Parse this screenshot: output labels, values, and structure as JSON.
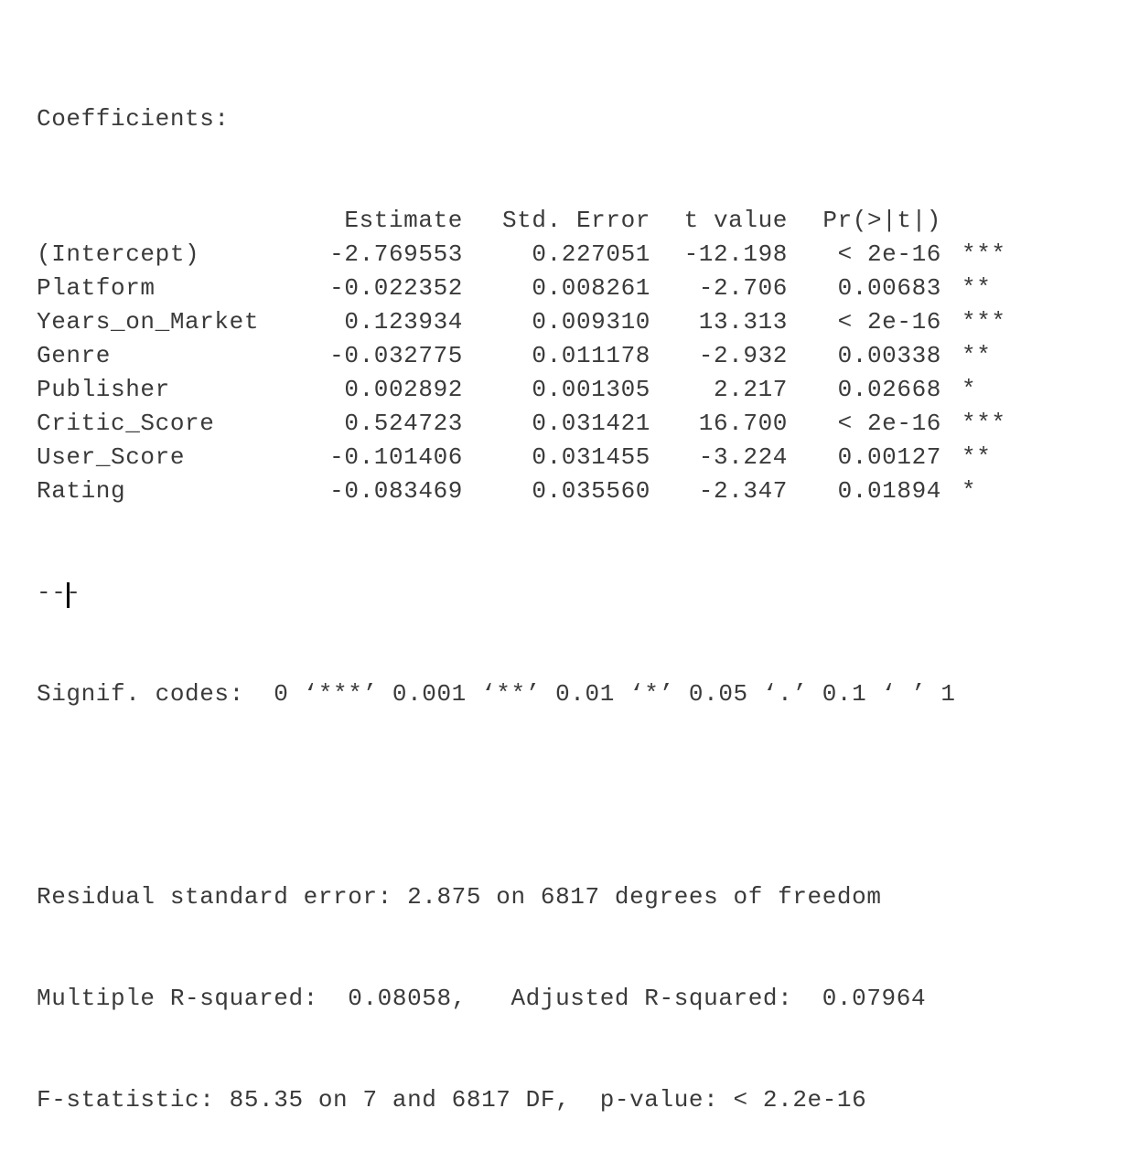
{
  "output": {
    "heading": "Coefficients:",
    "columns": [
      "",
      "Estimate",
      "Std. Error",
      "t value",
      "Pr(>|t|)",
      ""
    ],
    "rows": [
      {
        "name": "(Intercept)",
        "estimate": "-2.769553",
        "std_error": "0.227051",
        "t_value": "-12.198",
        "p_value": "< 2e-16",
        "signif": "***"
      },
      {
        "name": "Platform",
        "estimate": "-0.022352",
        "std_error": "0.008261",
        "t_value": "-2.706",
        "p_value": "0.00683",
        "signif": "**"
      },
      {
        "name": "Years_on_Market",
        "estimate": "0.123934",
        "std_error": "0.009310",
        "t_value": "13.313",
        "p_value": "< 2e-16",
        "signif": "***"
      },
      {
        "name": "Genre",
        "estimate": "-0.032775",
        "std_error": "0.011178",
        "t_value": "-2.932",
        "p_value": "0.00338",
        "signif": "**"
      },
      {
        "name": "Publisher",
        "estimate": "0.002892",
        "std_error": "0.001305",
        "t_value": "2.217",
        "p_value": "0.02668",
        "signif": "*"
      },
      {
        "name": "Critic_Score",
        "estimate": "0.524723",
        "std_error": "0.031421",
        "t_value": "16.700",
        "p_value": "< 2e-16",
        "signif": "***"
      },
      {
        "name": "User_Score",
        "estimate": "-0.101406",
        "std_error": "0.031455",
        "t_value": "-3.224",
        "p_value": "0.00127",
        "signif": "**"
      },
      {
        "name": "Rating",
        "estimate": "-0.083469",
        "std_error": "0.035560",
        "t_value": "-2.347",
        "p_value": "0.01894",
        "signif": "*"
      }
    ],
    "separator": "---",
    "signif_codes": "Signif. codes:  0 ‘***’ 0.001 ‘**’ 0.01 ‘*’ 0.05 ‘.’ 0.1 ‘ ’ 1",
    "residual_se": "Residual standard error: 2.875 on 6817 degrees of freedom",
    "r_squared": "Multiple R-squared:  0.08058,\tAdjusted R-squared:  0.07964",
    "f_statistic": "F-statistic: 85.35 on 7 and 6817 DF,  p-value: < 2.2e-16"
  }
}
